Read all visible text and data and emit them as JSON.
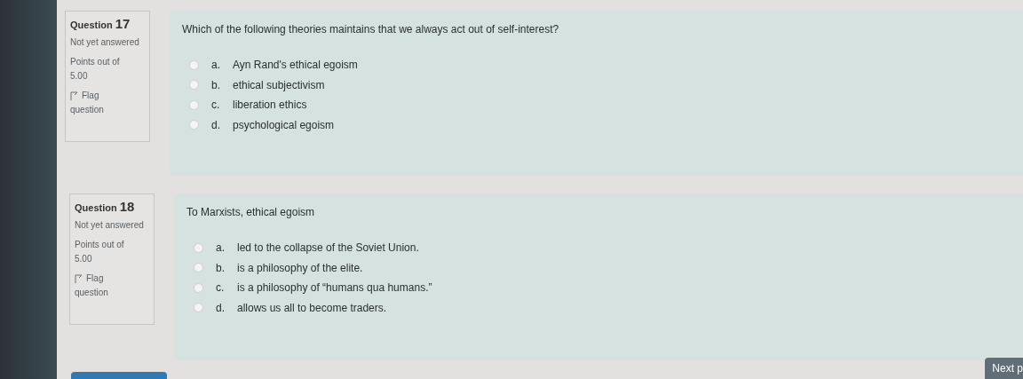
{
  "questions": [
    {
      "label": "Question",
      "number": "17",
      "status": "Not yet answered",
      "points_label": "Points out of",
      "points": "5.00",
      "flag": "Flag question",
      "text": "Which of the following theories maintains that we always act out of self-interest?",
      "options": [
        {
          "letter": "a.",
          "text": "Ayn Rand's ethical egoism",
          "selected": false
        },
        {
          "letter": "b.",
          "text": "ethical subjectivism",
          "selected": false
        },
        {
          "letter": "c.",
          "text": "liberation ethics",
          "selected": false
        },
        {
          "letter": "d.",
          "text": "psychological egoism",
          "selected": false
        }
      ]
    },
    {
      "label": "Question",
      "number": "18",
      "status": "Not yet answered",
      "points_label": "Points out of",
      "points": "5.00",
      "flag": "Flag question",
      "text": "To Marxists, ethical egoism",
      "options": [
        {
          "letter": "a.",
          "text": "led to the collapse of the Soviet Union.",
          "selected": false
        },
        {
          "letter": "b.",
          "text": "is a philosophy of the elite.",
          "selected": false
        },
        {
          "letter": "c.",
          "text": "is a philosophy of “humans qua humans.”",
          "selected": false
        },
        {
          "letter": "d.",
          "text": "allows us all to become traders.",
          "selected": false
        }
      ]
    }
  ],
  "next_button": "Next p"
}
